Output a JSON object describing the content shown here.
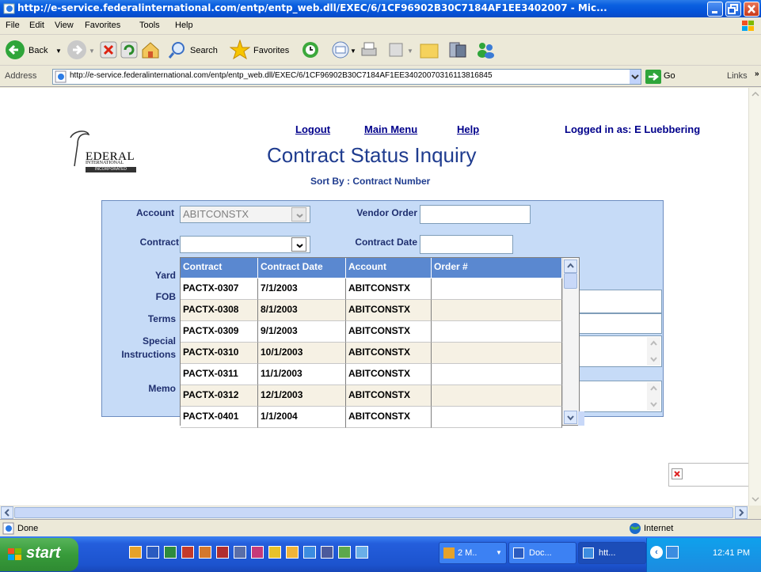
{
  "window": {
    "title": "http://e-service.federalinternational.com/entp/entp_web.dll/EXEC/6/1CF96902B30C7184AF1EE3402007 - Mic..."
  },
  "menu": [
    "File",
    "Edit",
    "View",
    "Favorites",
    "Tools",
    "Help"
  ],
  "toolbar": {
    "back": "Back",
    "search": "Search",
    "favorites": "Favorites"
  },
  "address": {
    "label": "Address",
    "url": "http://e-service.federalinternational.com/entp/entp_web.dll/EXEC/6/1CF96902B30C7184AF1EE34020070316113816845",
    "go": "Go",
    "links": "Links"
  },
  "logo": {
    "text": "EDERAL",
    "sub1": "INTERNATIONAL",
    "sub2": "INCORPORATED"
  },
  "nav": {
    "logout": "Logout",
    "main_menu": "Main Menu",
    "help": "Help",
    "logged_in": "Logged in as: E Luebbering"
  },
  "page": {
    "title": "Contract Status Inquiry",
    "sort_by": "Sort By : Contract Number"
  },
  "form": {
    "account_label": "Account",
    "account_value": "ABITCONSTX",
    "vendor_order_label": "Vendor Order",
    "contract_label": "Contract",
    "contract_date_label": "Contract Date",
    "yard_label": "Yard",
    "fob_label": "FOB",
    "terms_label": "Terms",
    "special_label_1": "Special",
    "special_label_2": "Instructions",
    "memo_label": "Memo"
  },
  "dropdown": {
    "columns": [
      "Contract",
      "Contract Date",
      "Account",
      "Order #"
    ],
    "rows": [
      [
        "PACTX-0307",
        "7/1/2003",
        "ABITCONSTX",
        ""
      ],
      [
        "PACTX-0308",
        "8/1/2003",
        "ABITCONSTX",
        ""
      ],
      [
        "PACTX-0309",
        "9/1/2003",
        "ABITCONSTX",
        ""
      ],
      [
        "PACTX-0310",
        "10/1/2003",
        "ABITCONSTX",
        ""
      ],
      [
        "PACTX-0311",
        "11/1/2003",
        "ABITCONSTX",
        ""
      ],
      [
        "PACTX-0312",
        "12/1/2003",
        "ABITCONSTX",
        ""
      ],
      [
        "PACTX-0401",
        "1/1/2004",
        "ABITCONSTX",
        ""
      ]
    ]
  },
  "status": {
    "text": "Done",
    "zone": "Internet"
  },
  "taskbar": {
    "start": "start",
    "buttons": [
      "2 M..",
      "Doc...",
      "htt..."
    ],
    "clock": "12:41 PM"
  },
  "colors": {
    "titlebar": "#0553D8",
    "panel": "#C6DBF7",
    "header": "#5A88D0",
    "row_alt": "#F6F1E4",
    "link": "#00008B"
  }
}
